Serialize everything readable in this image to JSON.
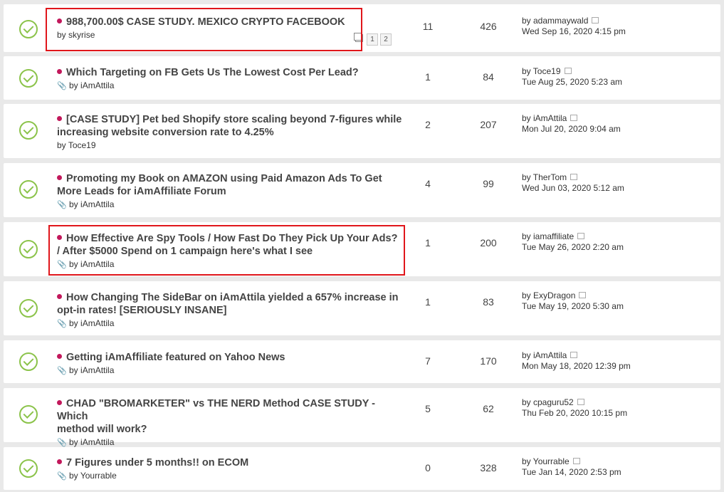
{
  "colors": {
    "unread_dot": "#c2185b",
    "check": "#8bc34a",
    "highlight": "#e0161b"
  },
  "topics": [
    {
      "title": "988,700.00$ CASE STUDY. MEXICO CRYPTO FACEBOOK",
      "title2": "",
      "author_prefix": "by",
      "author": "skyrise",
      "attachment": false,
      "replies": "11",
      "views": "426",
      "last_by": "by adammaywald",
      "last_time": "Wed Sep 16, 2020 4:15 pm",
      "pages": [
        "1",
        "2"
      ],
      "icon": "read-topic-check-icon"
    },
    {
      "title": "Which Targeting on FB Gets Us The Lowest Cost Per Lead?",
      "title2": "",
      "author_prefix": "by",
      "author": "iAmAttila",
      "attachment": true,
      "replies": "1",
      "views": "84",
      "last_by": "by Toce19",
      "last_time": "Tue Aug 25, 2020 5:23 am"
    },
    {
      "title": "[CASE STUDY] Pet bed Shopify store scaling beyond 7-figures while",
      "title2": "increasing website conversion rate to 4.25%",
      "author_prefix": "by",
      "author": "Toce19",
      "attachment": false,
      "replies": "2",
      "views": "207",
      "last_by": "by iAmAttila",
      "last_time": "Mon Jul 20, 2020 9:04 am"
    },
    {
      "title": "Promoting my Book on AMAZON using Paid Amazon Ads To Get",
      "title2": "More Leads for iAmAffiliate Forum",
      "author_prefix": "by",
      "author": "iAmAttila",
      "attachment": true,
      "replies": "4",
      "views": "99",
      "last_by": "by TherTom",
      "last_time": "Wed Jun 03, 2020 5:12 am"
    },
    {
      "title": "How Effective Are Spy Tools / How Fast Do They Pick Up Your Ads?",
      "title2": "/ After $5000 Spend on 1 campaign here's what I see",
      "author_prefix": "by",
      "author": "iAmAttila",
      "attachment": true,
      "replies": "1",
      "views": "200",
      "last_by": "by iamaffiliate",
      "last_time": "Tue May 26, 2020 2:20 am"
    },
    {
      "title": "How Changing The SideBar on iAmAttila yielded a 657% increase in",
      "title2": "opt-in rates! [SERIOUSLY INSANE]",
      "author_prefix": "by",
      "author": "iAmAttila",
      "attachment": true,
      "replies": "1",
      "views": "83",
      "last_by": "by ExyDragon",
      "last_time": "Tue May 19, 2020 5:30 am"
    },
    {
      "title": "Getting iAmAffiliate featured on Yahoo News",
      "title2": "",
      "author_prefix": "by",
      "author": "iAmAttila",
      "attachment": true,
      "replies": "7",
      "views": "170",
      "last_by": "by iAmAttila",
      "last_time": "Mon May 18, 2020 12:39 pm"
    },
    {
      "title": "CHAD \"BROMARKETER\" vs THE NERD Method CASE STUDY - Which",
      "title2": "method will work?",
      "author_prefix": "by",
      "author": "iAmAttila",
      "attachment": true,
      "replies": "5",
      "views": "62",
      "last_by": "by cpaguru52",
      "last_time": "Thu Feb 20, 2020 10:15 pm"
    },
    {
      "title": "7 Figures under 5 months!! on ECOM",
      "title2": "",
      "author_prefix": "by",
      "author": "Yourrable",
      "attachment": true,
      "replies": "0",
      "views": "328",
      "last_by": "by Yourrable",
      "last_time": "Tue Jan 14, 2020 2:53 pm"
    }
  ]
}
